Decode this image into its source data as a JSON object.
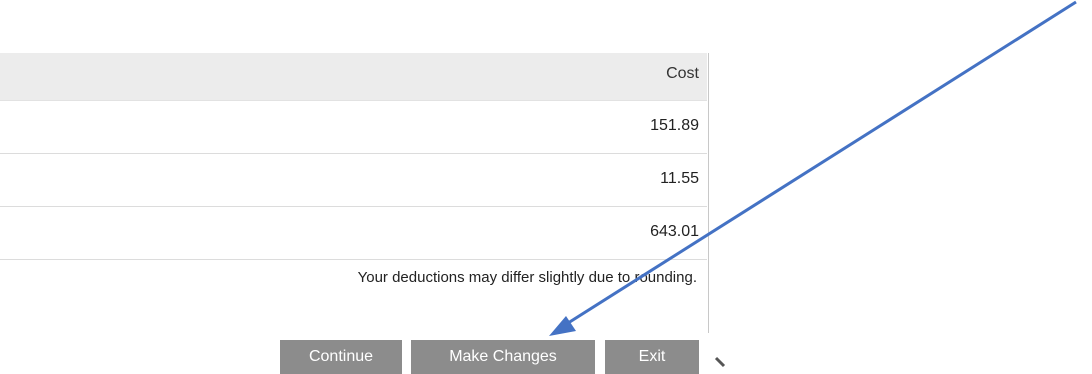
{
  "table": {
    "header": {
      "cost_label": "Cost"
    },
    "rows": [
      {
        "cost": "151.89"
      },
      {
        "cost": "11.55"
      },
      {
        "cost": "643.01"
      }
    ]
  },
  "note": "Your deductions may differ slightly due to rounding.",
  "buttons": {
    "continue_label": "Continue",
    "make_changes_label": "Make Changes",
    "exit_label": "Exit"
  },
  "annotation": {
    "arrow_color": "#4472c4",
    "arrow_target": "Make Changes"
  },
  "colors": {
    "button_bg": "#8c8c8c",
    "header_bg": "#ececec"
  }
}
